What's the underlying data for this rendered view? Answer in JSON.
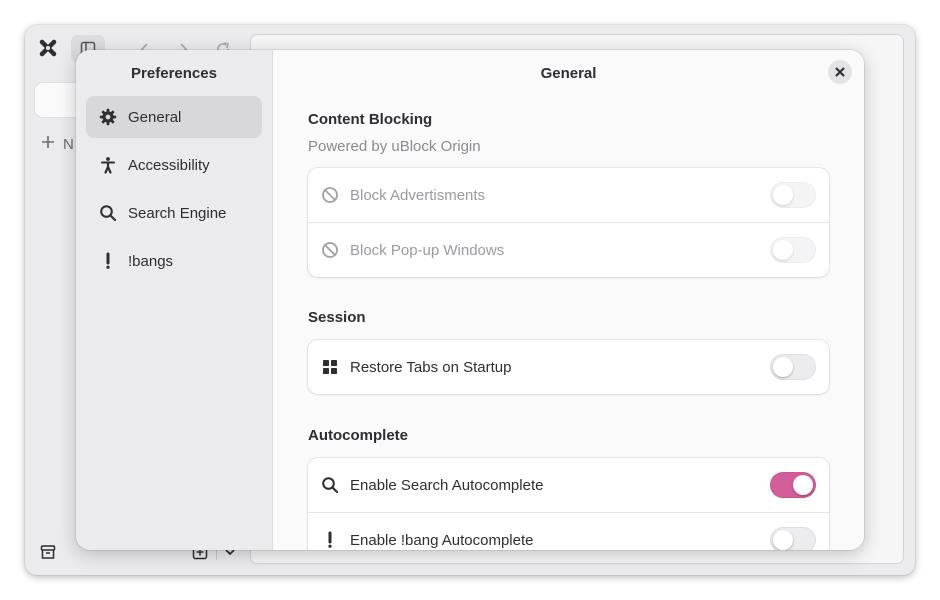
{
  "dialog": {
    "sidebar_title": "Preferences",
    "page_title": "General",
    "nav": [
      {
        "label": "General",
        "icon": "gear-icon",
        "active": true
      },
      {
        "label": "Accessibility",
        "icon": "accessibility-icon",
        "active": false
      },
      {
        "label": "Search Engine",
        "icon": "search-icon",
        "active": false
      },
      {
        "label": "!bangs",
        "icon": "exclamation-icon",
        "active": false
      }
    ]
  },
  "content_blocking": {
    "title": "Content Blocking",
    "subtitle": "Powered by uBlock Origin",
    "rows": [
      {
        "label": "Block Advertisments",
        "icon": "block-icon",
        "enabled": false,
        "sensitive": false
      },
      {
        "label": "Block Pop-up Windows",
        "icon": "block-icon",
        "enabled": false,
        "sensitive": false
      }
    ]
  },
  "session": {
    "title": "Session",
    "rows": [
      {
        "label": "Restore Tabs on Startup",
        "icon": "tabs-grid-icon",
        "enabled": false,
        "sensitive": true
      }
    ]
  },
  "autocomplete": {
    "title": "Autocomplete",
    "rows": [
      {
        "label": "Enable Search Autocomplete",
        "icon": "search-icon",
        "enabled": true,
        "sensitive": true
      },
      {
        "label": "Enable !bang Autocomplete",
        "icon": "exclamation-icon",
        "enabled": false,
        "sensitive": true
      }
    ]
  },
  "browser": {
    "new_tab_label": "N"
  },
  "colors": {
    "accent": "#d35d99",
    "dialog_bg": "#fafafb",
    "sidebar_bg": "#ebebed"
  }
}
